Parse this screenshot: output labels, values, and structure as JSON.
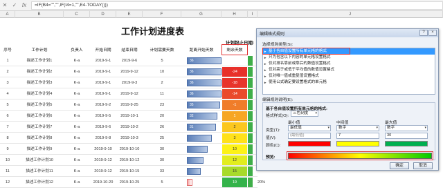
{
  "formula_bar": {
    "formula": "=IF(B4=\"\",\"\",IF(I4=1,\"\",E4-TODAY()))",
    "cancel_icon": "close-icon",
    "enter_icon": "check-icon",
    "fx_label": "fx"
  },
  "columns": [
    "A",
    "B",
    "C",
    "D",
    "E",
    "F",
    "G",
    "H",
    "I",
    "J"
  ],
  "sheet": {
    "title": "工作计划进度表",
    "start_label": "计划起止日期:",
    "headers": [
      "序号",
      "工作计划",
      "负责人",
      "开始日期",
      "结束日期",
      "计划需要天数",
      "距离开始天数",
      "剩余天数"
    ],
    "rows": [
      {
        "no": "1",
        "plan": "描述工作计划1",
        "owner": "K-a",
        "start": "2019-9-1",
        "end": "2019-9-6",
        "days": "5",
        "bar": "36",
        "remain": "",
        "color": "#ffffff",
        "text": "#333"
      },
      {
        "no": "2",
        "plan": "描述工作计划2",
        "owner": "K-a",
        "start": "2019-9-1",
        "end": "2019-9-12",
        "days": "10",
        "bar": "36",
        "remain": "-24",
        "color": "#e8302a",
        "text": "#fff"
      },
      {
        "no": "3",
        "plan": "描述工作计划3",
        "owner": "K-a",
        "start": "2019-9-1",
        "end": "2019-9-3",
        "days": "2",
        "bar": "36",
        "remain": "-18",
        "color": "#e8332b",
        "text": "#fff"
      },
      {
        "no": "4",
        "plan": "描述工作计划4",
        "owner": "K-a",
        "start": "2019-9-1",
        "end": "2019-9-12",
        "days": "11",
        "bar": "36",
        "remain": "-14",
        "color": "#ea4a2c",
        "text": "#fff"
      },
      {
        "no": "5",
        "plan": "描述工作计划5",
        "owner": "K-a",
        "start": "2019-9-2",
        "end": "2019-9-25",
        "days": "23",
        "bar": "35",
        "remain": "-1",
        "color": "#f07d2a",
        "text": "#fff"
      },
      {
        "no": "6",
        "plan": "描述工作计划6",
        "owner": "K-a",
        "start": "2019-9-5",
        "end": "2019-10-1",
        "days": "20",
        "bar": "32",
        "remain": "1",
        "color": "#f6a623",
        "text": "#fff"
      },
      {
        "no": "7",
        "plan": "描述工作计划7",
        "owner": "K-a",
        "start": "2019-9-6",
        "end": "2019-10-2",
        "days": "26",
        "bar": "31",
        "remain": "2",
        "color": "#fbc71f",
        "text": "#333"
      },
      {
        "no": "8",
        "plan": "描述工作计划8",
        "owner": "K-a",
        "start": "2019-9-8",
        "end": "2019-10-3",
        "days": "25",
        "bar": "",
        "remain": "3",
        "color": "#ffe11a",
        "text": "#333"
      },
      {
        "no": "9",
        "plan": "描述工作计划9",
        "owner": "K-a",
        "start": "2019-9-10",
        "end": "2019-10-10",
        "days": "30",
        "bar": "",
        "remain": "10",
        "color": "#fdf217",
        "text": "#333"
      },
      {
        "no": "10",
        "plan": "描述工作计划10",
        "owner": "K-a",
        "start": "2019-9-12",
        "end": "2019-10-12",
        "days": "30",
        "bar": "",
        "remain": "12",
        "color": "#e2ed1e",
        "text": "#333"
      },
      {
        "no": "11",
        "plan": "描述工作计划11",
        "owner": "K-a",
        "start": "2019-9-12",
        "end": "2019-10-15",
        "days": "33",
        "bar": "",
        "remain": "15",
        "color": "#a8da2a",
        "text": "#333"
      },
      {
        "no": "12",
        "plan": "描述工作计划12",
        "owner": "K-a",
        "start": "2019-10-20",
        "end": "2019-10-25",
        "days": "5",
        "bar": "",
        "remain": "19",
        "color": "#34b34a",
        "text": "#fff",
        "pct": "20%"
      }
    ]
  },
  "dialog": {
    "title": "编辑格式规则",
    "help_btn": "?",
    "close_btn": "×",
    "select_type_label": "选择规则类型(S):",
    "types": [
      "基于各自值设置所有单元格的格式",
      "只为包含以下内容的单元格设置格式",
      "仅对排名靠前或靠后的数值设置格式",
      "仅对高于或低于平均值的数值设置格式",
      "仅对唯一值或重复值设置格式",
      "使用公式确定要设置格式的单元格"
    ],
    "edit_desc_label": "编辑规则说明(E):",
    "format_all_label": "基于各自值设置所有单元格的格式:",
    "format_style_label": "格式样式(O):",
    "format_style_value": "三色刻度",
    "min_label": "最小值",
    "mid_label": "中间值",
    "max_label": "最大值",
    "type_label": "类型(T):",
    "value_label": "值(V):",
    "color_label": "颜色(C):",
    "min_type": "最低值",
    "mid_type": "数字",
    "max_type": "数字",
    "min_value": "(最低值)",
    "mid_value": "7",
    "max_value": "30",
    "min_color": "#ff0000",
    "mid_color": "#ffff00",
    "max_color": "#00b050",
    "preview_label": "预览:",
    "ok": "确定",
    "cancel": "取消"
  }
}
